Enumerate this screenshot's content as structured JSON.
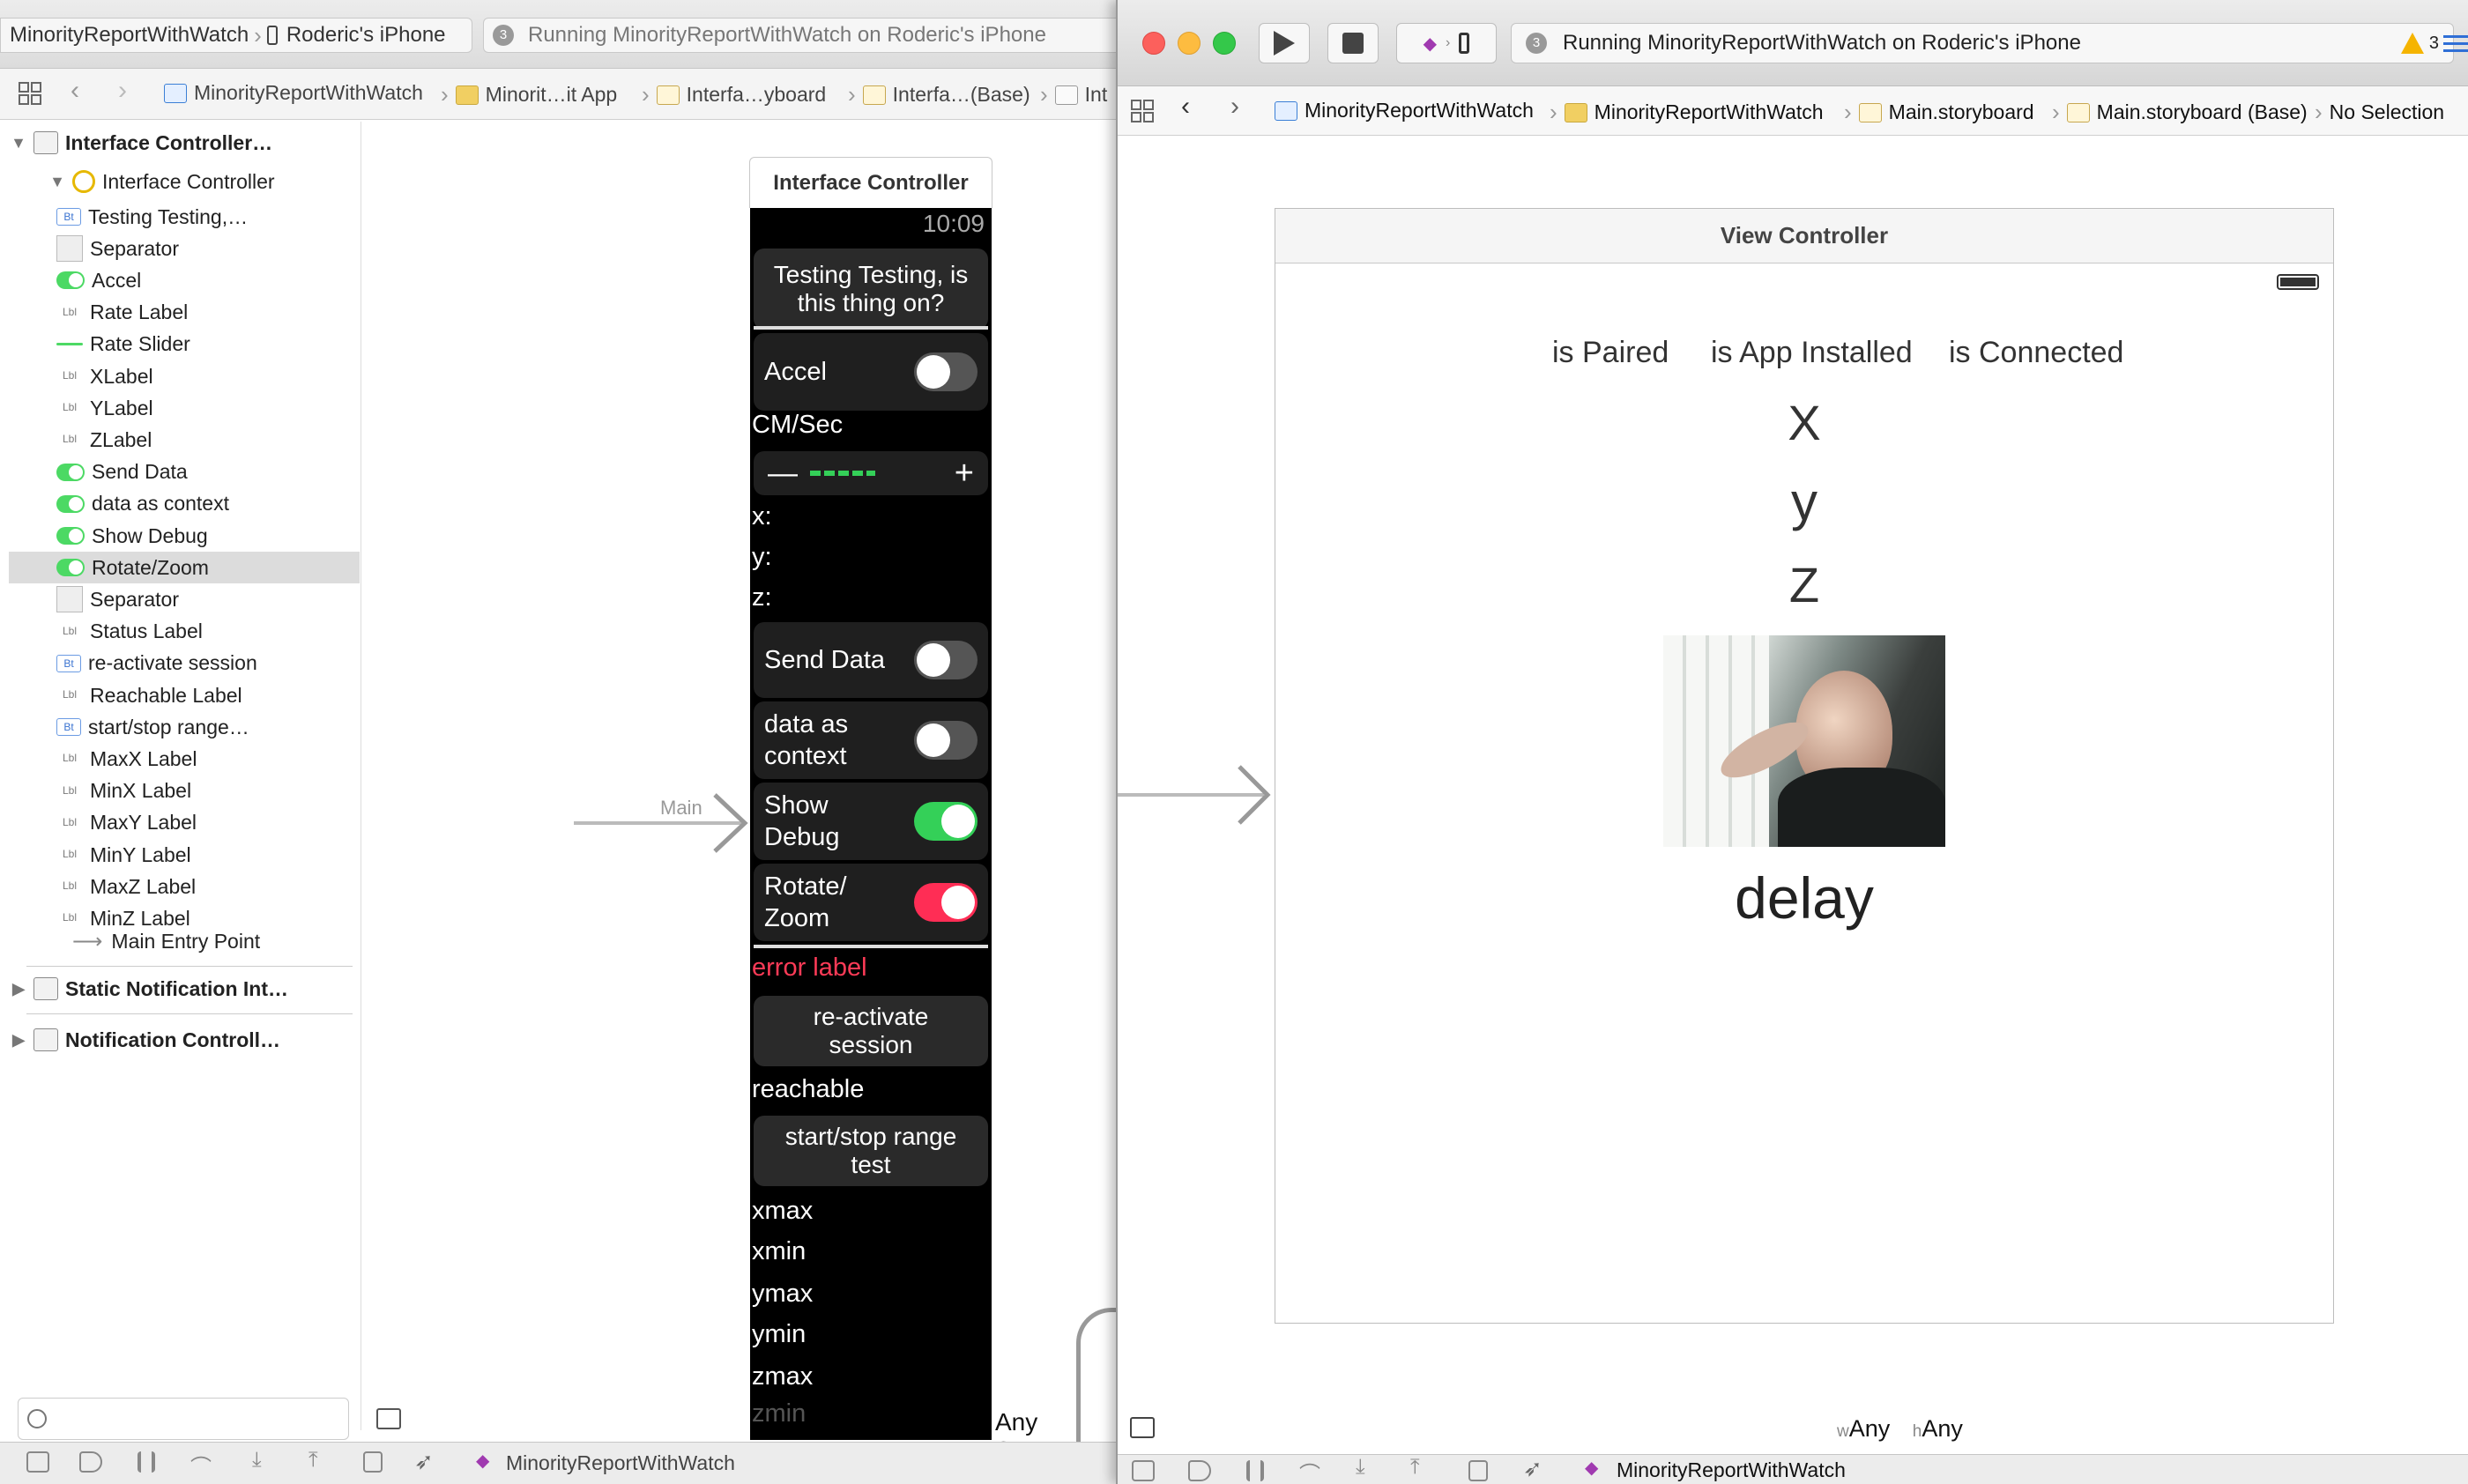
{
  "left_window": {
    "scheme": {
      "app": "MinorityReportWithWatch",
      "device": "Roderic's iPhone"
    },
    "status": {
      "badge": "3",
      "text": "Running MinorityReportWithWatch on Roderic's iPhone"
    },
    "jump_bar": [
      "MinorityReportWithWatch",
      "Minorit…it App",
      "Interfa…yboard",
      "Interfa…(Base)",
      "Int"
    ],
    "outline": {
      "scene1": "Interface Controller…",
      "controller": "Interface Controller",
      "items": [
        {
          "badge": "Bt",
          "kind": "bt",
          "label": "Testing Testing,…"
        },
        {
          "badge": "",
          "kind": "sep",
          "label": "Separator"
        },
        {
          "badge": "",
          "kind": "tog",
          "label": "Accel"
        },
        {
          "badge": "Lbl",
          "kind": "lbl",
          "label": "Rate Label"
        },
        {
          "badge": "",
          "kind": "sld",
          "label": "Rate Slider"
        },
        {
          "badge": "Lbl",
          "kind": "lbl",
          "label": "XLabel"
        },
        {
          "badge": "Lbl",
          "kind": "lbl",
          "label": "YLabel"
        },
        {
          "badge": "Lbl",
          "kind": "lbl",
          "label": "ZLabel"
        },
        {
          "badge": "",
          "kind": "tog",
          "label": "Send Data"
        },
        {
          "badge": "",
          "kind": "tog",
          "label": "data as context"
        },
        {
          "badge": "",
          "kind": "tog",
          "label": "Show Debug"
        },
        {
          "badge": "",
          "kind": "tog",
          "label": "Rotate/Zoom",
          "selected": true
        },
        {
          "badge": "",
          "kind": "sep",
          "label": "Separator"
        },
        {
          "badge": "Lbl",
          "kind": "lbl",
          "label": "Status Label"
        },
        {
          "badge": "Bt",
          "kind": "bt",
          "label": "re-activate session"
        },
        {
          "badge": "Lbl",
          "kind": "lbl",
          "label": "Reachable Label"
        },
        {
          "badge": "Bt",
          "kind": "bt",
          "label": "start/stop range…"
        },
        {
          "badge": "Lbl",
          "kind": "lbl",
          "label": "MaxX Label"
        },
        {
          "badge": "Lbl",
          "kind": "lbl",
          "label": "MinX Label"
        },
        {
          "badge": "Lbl",
          "kind": "lbl",
          "label": "MaxY Label"
        },
        {
          "badge": "Lbl",
          "kind": "lbl",
          "label": "MinY Label"
        },
        {
          "badge": "Lbl",
          "kind": "lbl",
          "label": "MaxZ Label"
        },
        {
          "badge": "Lbl",
          "kind": "lbl",
          "label": "MinZ Label"
        }
      ],
      "entry_point": "Main Entry Point",
      "scene2": "Static Notification Int…",
      "scene3": "Notification Controll…"
    },
    "canvas": {
      "entry_label": "Main",
      "any_screen": "Any Screen",
      "watch": {
        "title": "Interface Controller",
        "time": "10:09",
        "testing_button": "Testing Testing, is this thing on?",
        "accel": "Accel",
        "rate": "CM/Sec",
        "x": "x:",
        "y": "y:",
        "z": "z:",
        "send_data": "Send Data",
        "data_as_context": "data as context",
        "show_debug": "Show Debug",
        "rotate_zoom": "Rotate/ Zoom",
        "error_label": "error label",
        "reactivate": "re-activate session",
        "reachable": "reachable",
        "range": "start/stop range test",
        "xmax": "xmax",
        "xmin": "xmin",
        "ymax": "ymax",
        "ymin": "ymin",
        "zmax": "zmax",
        "zmin": "zmin"
      }
    },
    "bottom_scheme": "MinorityReportWithWatch"
  },
  "right_window": {
    "status": {
      "badge": "3",
      "text": "Running MinorityReportWithWatch on Roderic's iPhone",
      "warnings": "3"
    },
    "jump_bar": [
      "MinorityReportWithWatch",
      "MinorityReportWithWatch",
      "Main.storyboard",
      "Main.storyboard (Base)",
      "No Selection"
    ],
    "view_controller": {
      "title": "View Controller",
      "is_paired": "is Paired",
      "is_app_installed": "is App Installed",
      "is_connected": "is Connected",
      "x": "X",
      "y": "y",
      "z": "Z",
      "delay": "delay"
    },
    "size_class": {
      "w": "w",
      "w_val": "Any",
      "h": "h",
      "h_val": "Any"
    },
    "bottom_scheme": "MinorityReportWithWatch"
  },
  "colors": {
    "accent_green": "#4cd964",
    "accent_red": "#ff2d55",
    "error_red": "#ff3b57",
    "selection": "#dcdcdc"
  }
}
